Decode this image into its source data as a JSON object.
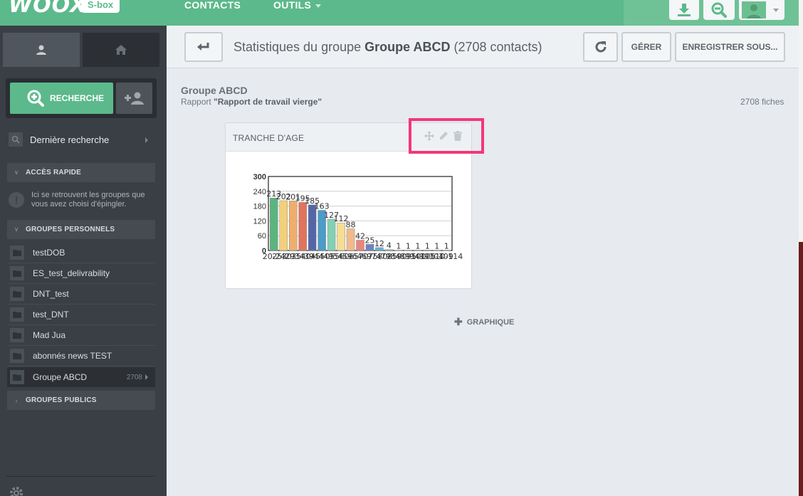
{
  "topbar": {
    "logo_text": "WOOX",
    "badge": "S-box",
    "nav": [
      {
        "label": "CONTACTS"
      },
      {
        "label": "OUTILS"
      }
    ]
  },
  "sidebar": {
    "search_button": "RECHERCHE",
    "last_search": "Dernière recherche",
    "quick_access_title": "ACCÈS RAPIDE",
    "quick_access_info": "Ici se retrouvent les groupes que vous avez choisi d'épingler.",
    "personal_groups_title": "GROUPES PERSONNELS",
    "groups": [
      {
        "label": "testDOB"
      },
      {
        "label": "ES_test_delivrability"
      },
      {
        "label": "DNT_test"
      },
      {
        "label": "test_DNT"
      },
      {
        "label": "Mad Jua"
      },
      {
        "label": "abonnés news TEST"
      },
      {
        "label": "Groupe ABCD",
        "count": "2708"
      }
    ],
    "public_groups_title": "GROUPES PUBLICS"
  },
  "header": {
    "title_prefix": "Statistiques du groupe ",
    "title_group": "Groupe ABCD",
    "title_suffix": " (2708 contacts)",
    "manage_label": "GÉRER",
    "save_as_label": "ENREGISTRER SOUS..."
  },
  "content": {
    "group_name": "Groupe ABCD",
    "report_prefix": "Rapport ",
    "report_name": "\"Rapport de travail vierge\"",
    "fiches": "2708 fiches",
    "widget_title": "TRANCHE D'AGE",
    "add_chart_label": "GRAPHIQUE"
  },
  "chart_data": {
    "type": "bar",
    "title": "",
    "xlabel": "",
    "ylabel": "",
    "ylim": [
      0,
      300
    ],
    "yticks": [
      "0",
      "60",
      "120",
      "180",
      "240",
      "300"
    ],
    "categories": [
      "20-24",
      "25-29",
      "30-34",
      "35-39",
      "40-44",
      "45-49",
      "50-54",
      "55-59",
      "60-64",
      "65-69",
      "70-74",
      "75-79",
      "80-84",
      "85-89",
      "90-94",
      "95-99",
      "100-104",
      "105-109",
      "110-114"
    ],
    "values": [
      213,
      202,
      201,
      195,
      185,
      163,
      127,
      112,
      88,
      42,
      25,
      12,
      4,
      1,
      1,
      1,
      1,
      1,
      1
    ],
    "colors": [
      "#5bb47f",
      "#f2cf7a",
      "#efae6c",
      "#e0745e",
      "#5566a8",
      "#4b9cc8",
      "#84d0b2",
      "#f6dd92",
      "#f2b98b",
      "#e9867c",
      "#6d83c4",
      "#65b3d8",
      "#8fd4b3",
      "#f3d38c",
      "#efba84",
      "#e99382",
      "#7990cc",
      "#70bde2",
      "#8ed7b9"
    ],
    "grid": true,
    "legend": "none"
  }
}
